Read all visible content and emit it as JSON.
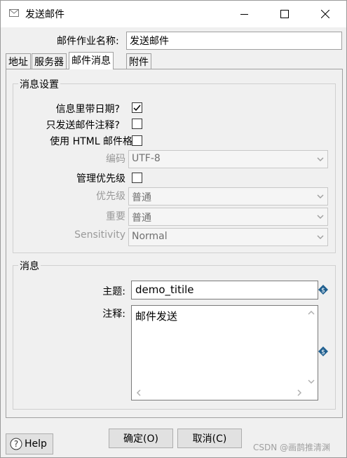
{
  "window": {
    "title": "发送邮件",
    "icon": "mail-icon"
  },
  "job_name": {
    "label": "邮件作业名称:",
    "value": "发送邮件"
  },
  "tabs": [
    "地址",
    "服务器",
    "邮件消息",
    "附件"
  ],
  "active_tab": "邮件消息",
  "message_settings": {
    "title": "消息设置",
    "include_date": {
      "label": "信息里带日期?",
      "checked": true
    },
    "only_comment": {
      "label": "只发送邮件注释?",
      "checked": false
    },
    "use_html": {
      "label": "使用 HTML 邮件格",
      "checked": false
    },
    "encoding": {
      "label": "编码",
      "value": "UTF-8"
    },
    "manage_priority": {
      "label": "管理优先级",
      "checked": false
    },
    "priority": {
      "label": "优先级",
      "value": "普通"
    },
    "importance": {
      "label": "重要",
      "value": "普通"
    },
    "sensitivity": {
      "label": "Sensitivity",
      "value": "Normal"
    }
  },
  "message": {
    "title": "消息",
    "subject": {
      "label": "主题:",
      "value": "demo_titile"
    },
    "comment": {
      "label": "注释:",
      "value": "邮件发送"
    }
  },
  "buttons": {
    "help": "Help",
    "ok": "确定(O)",
    "cancel": "取消(C)"
  },
  "watermark": "CSDN @画鹊推清渊",
  "colors": {
    "variable_icon": "#1f5f8f",
    "text_disabled": "#9a9a9a"
  }
}
